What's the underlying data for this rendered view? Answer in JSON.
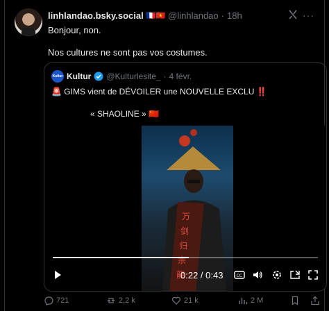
{
  "post": {
    "author_name": "linhlandao.bsky.social",
    "flags": "🇫🇷🇻🇳",
    "handle": "@linhlandao",
    "separator": "·",
    "time": "18h",
    "text_line1": "Bonjour, non.",
    "text_line2": "Nos cultures ne sont pas vos costumes."
  },
  "quote": {
    "avatar_text": "Kultur",
    "author_name": "Kultur",
    "handle": "@Kulturlesite_",
    "separator": "·",
    "date": "4 févr.",
    "line1": "🚨 GIMS vient de DÉVOILER une NOUVELLE EXCLU ‼️",
    "line2": "« SHAOLINE » 🇨🇳"
  },
  "video": {
    "time_display": "0:22 / 0:43",
    "progress": 0.512,
    "overlay_glyphs": [
      "万",
      "剑",
      "归",
      "宗",
      "龍"
    ]
  },
  "actions": {
    "replies": "721",
    "reposts": "2,2 k",
    "likes": "21 k",
    "views": "2 M"
  },
  "icons": [
    "grok-icon",
    "more-icon",
    "verified-icon",
    "play-icon",
    "cc-icon",
    "volume-icon",
    "settings-icon",
    "pip-icon",
    "fullscreen-icon",
    "reply-icon",
    "repost-icon",
    "like-icon",
    "views-icon",
    "bookmark-icon",
    "share-icon"
  ],
  "colors": {
    "background": "#000000",
    "text": "#e7e9ea",
    "muted": "#71767b",
    "border": "#2f3336",
    "verified": "#1d9bf0"
  }
}
